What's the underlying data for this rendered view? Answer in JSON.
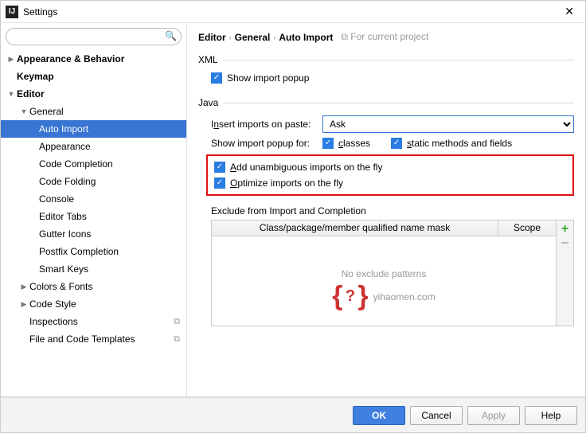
{
  "window": {
    "title": "Settings"
  },
  "search": {
    "placeholder": ""
  },
  "tree": {
    "appearance_behavior": "Appearance & Behavior",
    "keymap": "Keymap",
    "editor": "Editor",
    "general": "General",
    "auto_import": "Auto Import",
    "appearance": "Appearance",
    "code_completion": "Code Completion",
    "code_folding": "Code Folding",
    "console": "Console",
    "editor_tabs": "Editor Tabs",
    "gutter_icons": "Gutter Icons",
    "postfix_completion": "Postfix Completion",
    "smart_keys": "Smart Keys",
    "colors_fonts": "Colors & Fonts",
    "code_style": "Code Style",
    "inspections": "Inspections",
    "file_code_templates": "File and Code Templates"
  },
  "breadcrumb": {
    "a": "Editor",
    "b": "General",
    "c": "Auto Import",
    "hint": "For current project"
  },
  "xml": {
    "group": "XML",
    "show_popup": "Show import popup"
  },
  "java": {
    "group": "Java",
    "insert_label_pre": "I",
    "insert_label_und": "n",
    "insert_label_post": "sert imports on paste:",
    "insert_value": "Ask",
    "popup_for": "Show import popup for:",
    "classes_und": "c",
    "classes_post": "lasses",
    "static_und": "s",
    "static_post": "tatic methods and fields",
    "add_und": "A",
    "add_post": "dd unambiguous imports on the fly",
    "opt_und": "O",
    "opt_post": "ptimize imports on the fly",
    "exclude_label": "Exclude from Import and Completion",
    "col1": "Class/package/member qualified name mask",
    "col2": "Scope",
    "empty": "No exclude patterns"
  },
  "watermark": "yihaomen.com",
  "buttons": {
    "ok": "OK",
    "cancel": "Cancel",
    "apply": "Apply",
    "help": "Help"
  }
}
